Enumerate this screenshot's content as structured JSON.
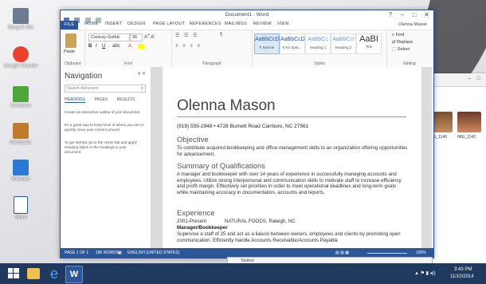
{
  "desktop": {
    "icons": [
      {
        "label": "Recycle Bin",
        "color": "#6b7c90"
      },
      {
        "label": "Google Chrome",
        "color": "#e8412c"
      },
      {
        "label": "Camtasia",
        "color": "#4da63c"
      },
      {
        "label": "Bandicam",
        "color": "#c07a2c"
      },
      {
        "label": "Webcam",
        "color": "#2b79d4"
      },
      {
        "label": "Word",
        "color": "#2b579a"
      }
    ]
  },
  "word": {
    "title": "Document1 - Word",
    "tabs": [
      "FILE",
      "HOME",
      "INSERT",
      "DESIGN",
      "PAGE LAYOUT",
      "REFERENCES",
      "MAILINGS",
      "REVIEW",
      "VIEW"
    ],
    "user": "Olenna Mason",
    "ribbon": {
      "clipboard_label": "Clipboard",
      "paste_label": "Paste",
      "font_group_label": "Font",
      "font_name": "Century Gothic",
      "font_size": "26",
      "paragraph_label": "Paragraph",
      "styles_label": "Styles",
      "styles": [
        {
          "sample": "AaBbCcDc",
          "name": "¶ Normal"
        },
        {
          "sample": "AaBbCcDc",
          "name": "¶ No Spac..."
        },
        {
          "sample": "AaBbCc",
          "name": "Heading 1"
        },
        {
          "sample": "AaBbCcI",
          "name": "Heading 2"
        },
        {
          "sample": "AaBI",
          "name": "Title"
        }
      ],
      "editing_label": "Editing",
      "find": "Find",
      "replace": "Replace",
      "select": "Select"
    },
    "nav": {
      "title": "Navigation",
      "search_placeholder": "Search document",
      "tabs": [
        "HEADINGS",
        "PAGES",
        "RESULTS"
      ],
      "text_1": "Create an interactive outline of your document.",
      "text_2": "It's a great way to keep track of where you are or quickly move your content around.",
      "text_3": "To get started, go to the Home tab and apply Heading styles to the headings in your document."
    },
    "doc": {
      "name": "Olenna Mason",
      "contact": "(919) 555-2948 • 4728 Burnett Road Carrboro, NC 27561",
      "objective_heading": "Objective",
      "objective_text": "To contribute acquired bookkeeping and office management skills to an organization offering opportunities for advancement.",
      "summary_heading": "Summary of Qualifications",
      "summary_text": "A manager and bookkeeper with over 14 years of experience in successfully managing accounts and employees. Utilize strong interpersonal and communication skills to motivate staff to increase efficiency and profit margin. Effectively set priorities in order to meet operational deadlines and long-term goals while maintaining accuracy in documentation, accounts and reports.",
      "experience_heading": "Experience",
      "job_dates": "2001-Present",
      "job_company": "NATURAL FOODS, Raleigh, NC",
      "job_title": "Manager/Bookkeeper",
      "job_text": "Supervise a staff of 25 and act as a liaison between owners, employees and clients by promoting open communication. Efficiently handle Accounts Receivable/Accounts Payable"
    },
    "status": {
      "page": "PAGE 1 OF 1",
      "words": "186 WORDS",
      "language": "ENGLISH (UNITED STATES)",
      "zoom": "100%"
    }
  },
  "back_window": {
    "captions": [
      "IMG_1140",
      "IMG_1142"
    ]
  },
  "taskbar": {
    "preview_text": "Taskbar",
    "time": "3:43 PM",
    "date": "11/10/2014"
  }
}
